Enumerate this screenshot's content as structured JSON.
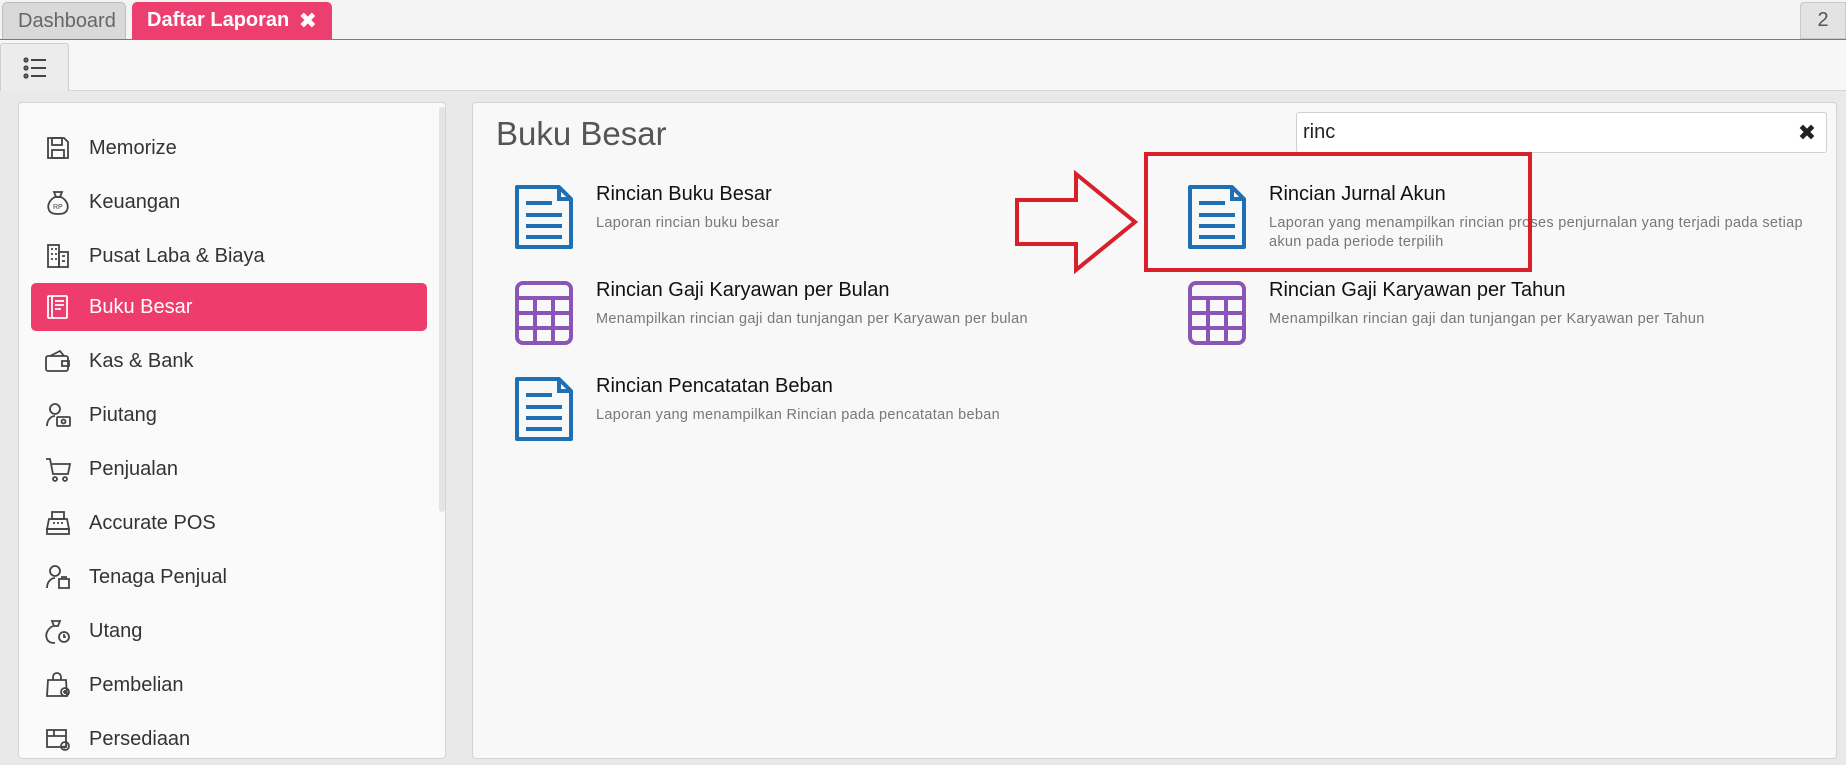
{
  "tabs": {
    "dashboard": "Dashboard",
    "active": "Daftar Laporan",
    "close_glyph": "✖",
    "count": "2"
  },
  "toolbar": {
    "menu_icon": "list-menu-icon"
  },
  "sidebar": {
    "items": [
      {
        "label": "Memorize",
        "icon": "save-icon"
      },
      {
        "label": "Keuangan",
        "icon": "money-bag-icon"
      },
      {
        "label": "Pusat Laba & Biaya",
        "icon": "building-icon"
      },
      {
        "label": "Buku Besar",
        "icon": "ledger-book-icon"
      },
      {
        "label": "Kas & Bank",
        "icon": "wallet-icon"
      },
      {
        "label": "Piutang",
        "icon": "person-money-icon"
      },
      {
        "label": "Penjualan",
        "icon": "cart-icon"
      },
      {
        "label": "Accurate POS",
        "icon": "cash-register-icon"
      },
      {
        "label": "Tenaga Penjual",
        "icon": "salesperson-icon"
      },
      {
        "label": "Utang",
        "icon": "money-bag-clock-icon"
      },
      {
        "label": "Pembelian",
        "icon": "shopping-bag-icon"
      },
      {
        "label": "Persediaan",
        "icon": "inventory-box-icon"
      }
    ],
    "active_index": 3
  },
  "main": {
    "title": "Buku Besar",
    "search": {
      "value": "rinc",
      "clear_glyph": "✖"
    },
    "reports": [
      {
        "title": "Rincian Buku Besar",
        "desc": "Laporan rincian buku besar",
        "icon": "document-icon"
      },
      {
        "title": "Rincian Jurnal Akun",
        "desc": "Laporan yang menampilkan rincian proses penjurnalan yang terjadi pada setiap akun pada periode terpilih",
        "icon": "document-icon"
      },
      {
        "title": "Rincian Gaji Karyawan per Bulan",
        "desc": "Menampilkan rincian gaji dan tunjangan per Karyawan per bulan",
        "icon": "table-grid-icon"
      },
      {
        "title": "Rincian Gaji Karyawan per Tahun",
        "desc": "Menampilkan rincian gaji dan tunjangan per Karyawan per Tahun",
        "icon": "table-grid-icon"
      },
      {
        "title": "Rincian Pencatatan Beban",
        "desc": "Laporan yang menampilkan Rincian pada pencatatan beban",
        "icon": "document-icon"
      }
    ]
  },
  "colors": {
    "accent": "#ed3f6f",
    "doc_icon": "#1f6fb5",
    "grid_icon": "#8a55b5",
    "annotation": "#d8202b"
  }
}
